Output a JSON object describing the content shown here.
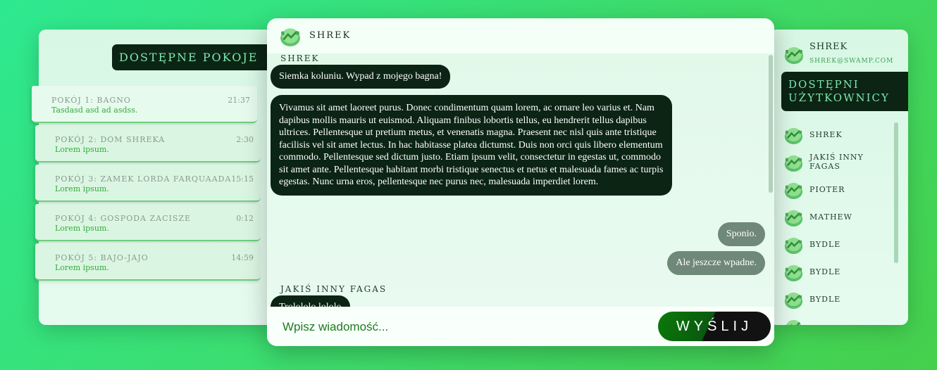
{
  "rooms": {
    "title": "DOSTĘPNE POKOJE",
    "items": [
      {
        "name": "POKÓJ 1: BAGNO",
        "time": "21:37",
        "last": "Tasdasd asd ad asdss."
      },
      {
        "name": "POKÓJ 2: DOM SHREKA",
        "time": "2:30",
        "last": "Lorem ipsum."
      },
      {
        "name": "POKÓJ 3: ZAMEK LORDA FARQUAADA",
        "time": "15:15",
        "last": "Lorem ipsum."
      },
      {
        "name": "POKÓJ 4: GOSPODA ZACISZE",
        "time": "0:12",
        "last": "Lorem ipsum."
      },
      {
        "name": "POKÓJ 5: BAJO-JAJO",
        "time": "14:59",
        "last": "Lorem ipsum."
      }
    ]
  },
  "chat": {
    "title": "SHREK",
    "messages": [
      {
        "sender": "SHREK",
        "text": "Siemka koluniu. Wypad z mojego bagna!"
      },
      {
        "text": "Vivamus sit amet laoreet purus. Donec condimentum quam lorem, ac ornare leo varius et. Nam dapibus mollis mauris ut euismod. Aliquam finibus lobortis tellus, eu hendrerit tellus dapibus ultrices. Pellentesque ut pretium metus, et venenatis magna. Praesent nec nisl quis ante tristique facilisis vel sit amet lectus. In hac habitasse platea dictumst. Duis non orci quis libero elementum commodo. Pellentesque sed dictum justo. Etiam ipsum velit, consectetur in egestas ut, commodo sit amet ante. Pellentesque habitant morbi tristique senectus et netus et malesuada fames ac turpis egestas. Nunc urna eros, pellentesque nec purus nec, malesuada imperdiet lorem."
      },
      {
        "text": "Sponio."
      },
      {
        "text": "Ale jeszcze wpadne."
      },
      {
        "sender": "JAKIŚ INNY FAGAS",
        "text": "Trolololo lololo"
      }
    ],
    "input_placeholder": "Wpisz wiadomość...",
    "send_label": "WYŚLIJ"
  },
  "profile": {
    "name": "SHREK",
    "email": "SHREK@SWAMP.COM"
  },
  "users": {
    "title_line1": "DOSTĘPNI",
    "title_line2": "UŻYTKOWNICY",
    "items": [
      "SHREK",
      "JAKIŚ INNY FAGAS",
      "PIOTER",
      "MATHEW",
      "BYDLE",
      "BYDLE",
      "BYDLE"
    ]
  },
  "colors": {
    "dark": "#0b2414",
    "accent_text": "#7fe8b0",
    "outgoing_bubble": "#6f8877",
    "green_text": "#37a83d"
  },
  "icons": {
    "avatar": "shrek-avatar-icon"
  }
}
